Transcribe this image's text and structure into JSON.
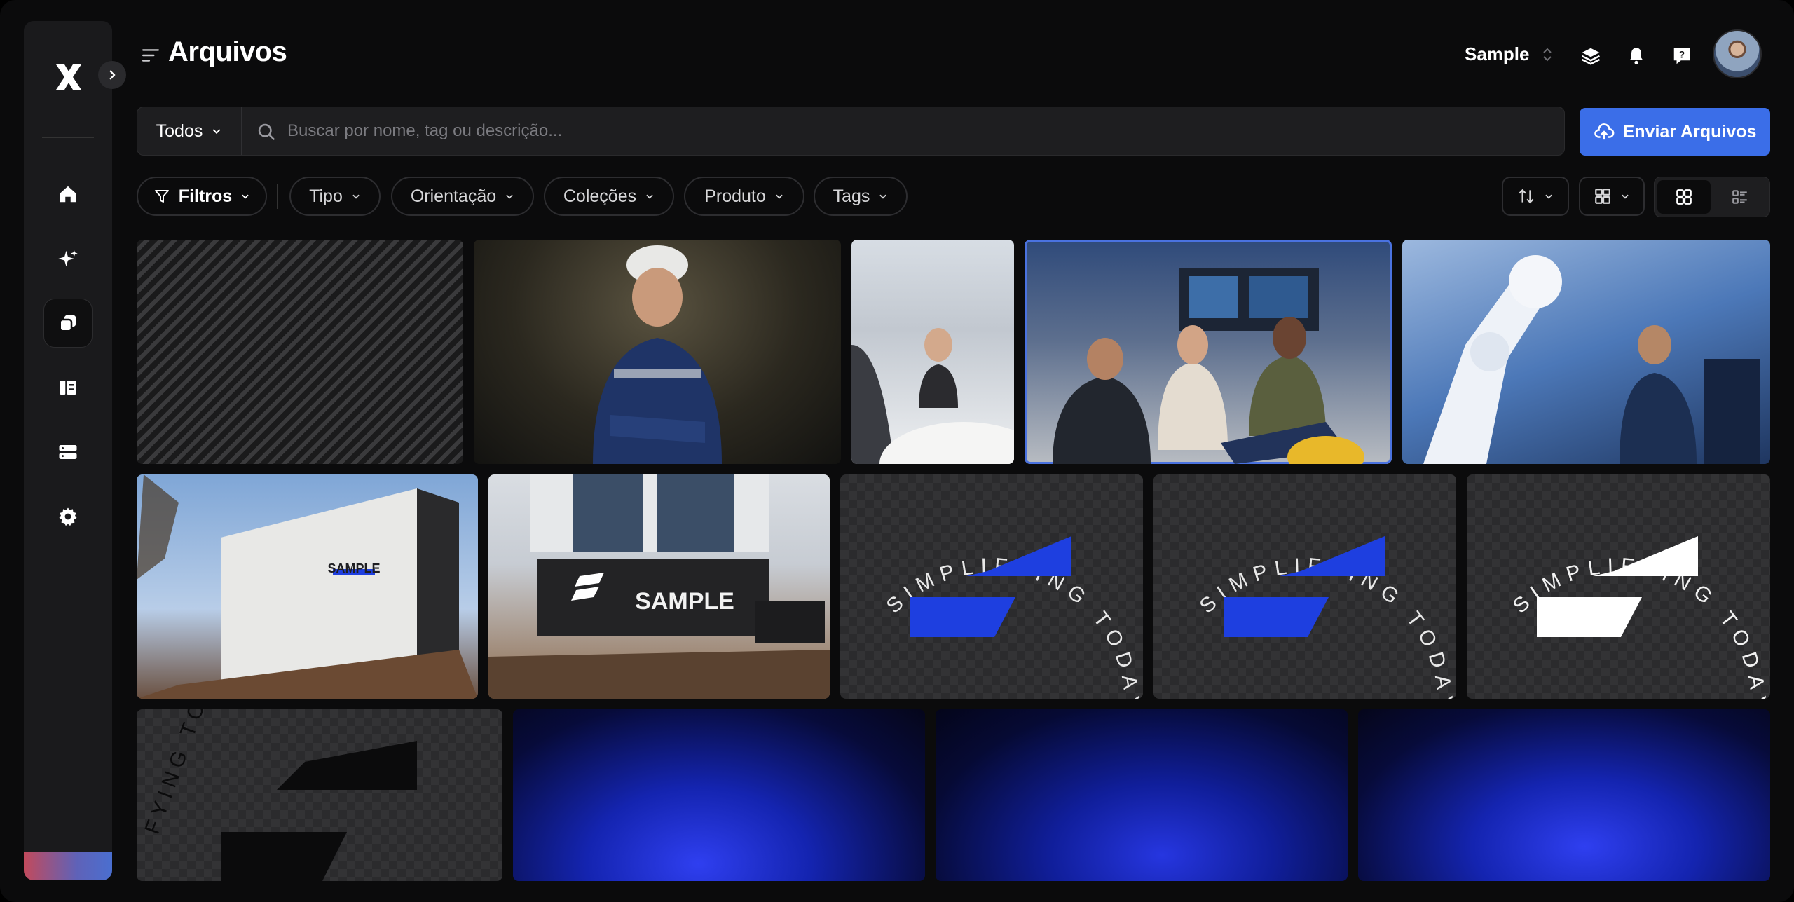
{
  "header": {
    "title": "Arquivos",
    "workspace": "Sample"
  },
  "search": {
    "scope": "Todos",
    "placeholder": "Buscar por nome, tag ou descrição...",
    "value": ""
  },
  "upload_button": {
    "label": "Enviar Arquivos"
  },
  "filters": [
    {
      "label": "Filtros"
    },
    {
      "label": "Tipo"
    },
    {
      "label": "Orientação"
    },
    {
      "label": "Coleções"
    },
    {
      "label": "Produto"
    },
    {
      "label": "Tags"
    }
  ],
  "sidebar": {
    "items": [
      {
        "icon": "home-icon"
      },
      {
        "icon": "sparkles-icon"
      },
      {
        "icon": "assets-icon",
        "active": true
      },
      {
        "icon": "book-icon"
      },
      {
        "icon": "server-icon"
      },
      {
        "icon": "gear-icon"
      }
    ]
  },
  "view": {
    "active": "grid"
  },
  "gallery": {
    "sign_text": "SAMPLE",
    "circular_text": "SIMPLIFYING TODAY | ENGINEERING T",
    "row3_circular_text": "FYING TO ENGINEER"
  },
  "colors": {
    "accent": "#3b6ee8",
    "brand_blue": "#1e3fe0",
    "background": "#0b0b0c"
  }
}
